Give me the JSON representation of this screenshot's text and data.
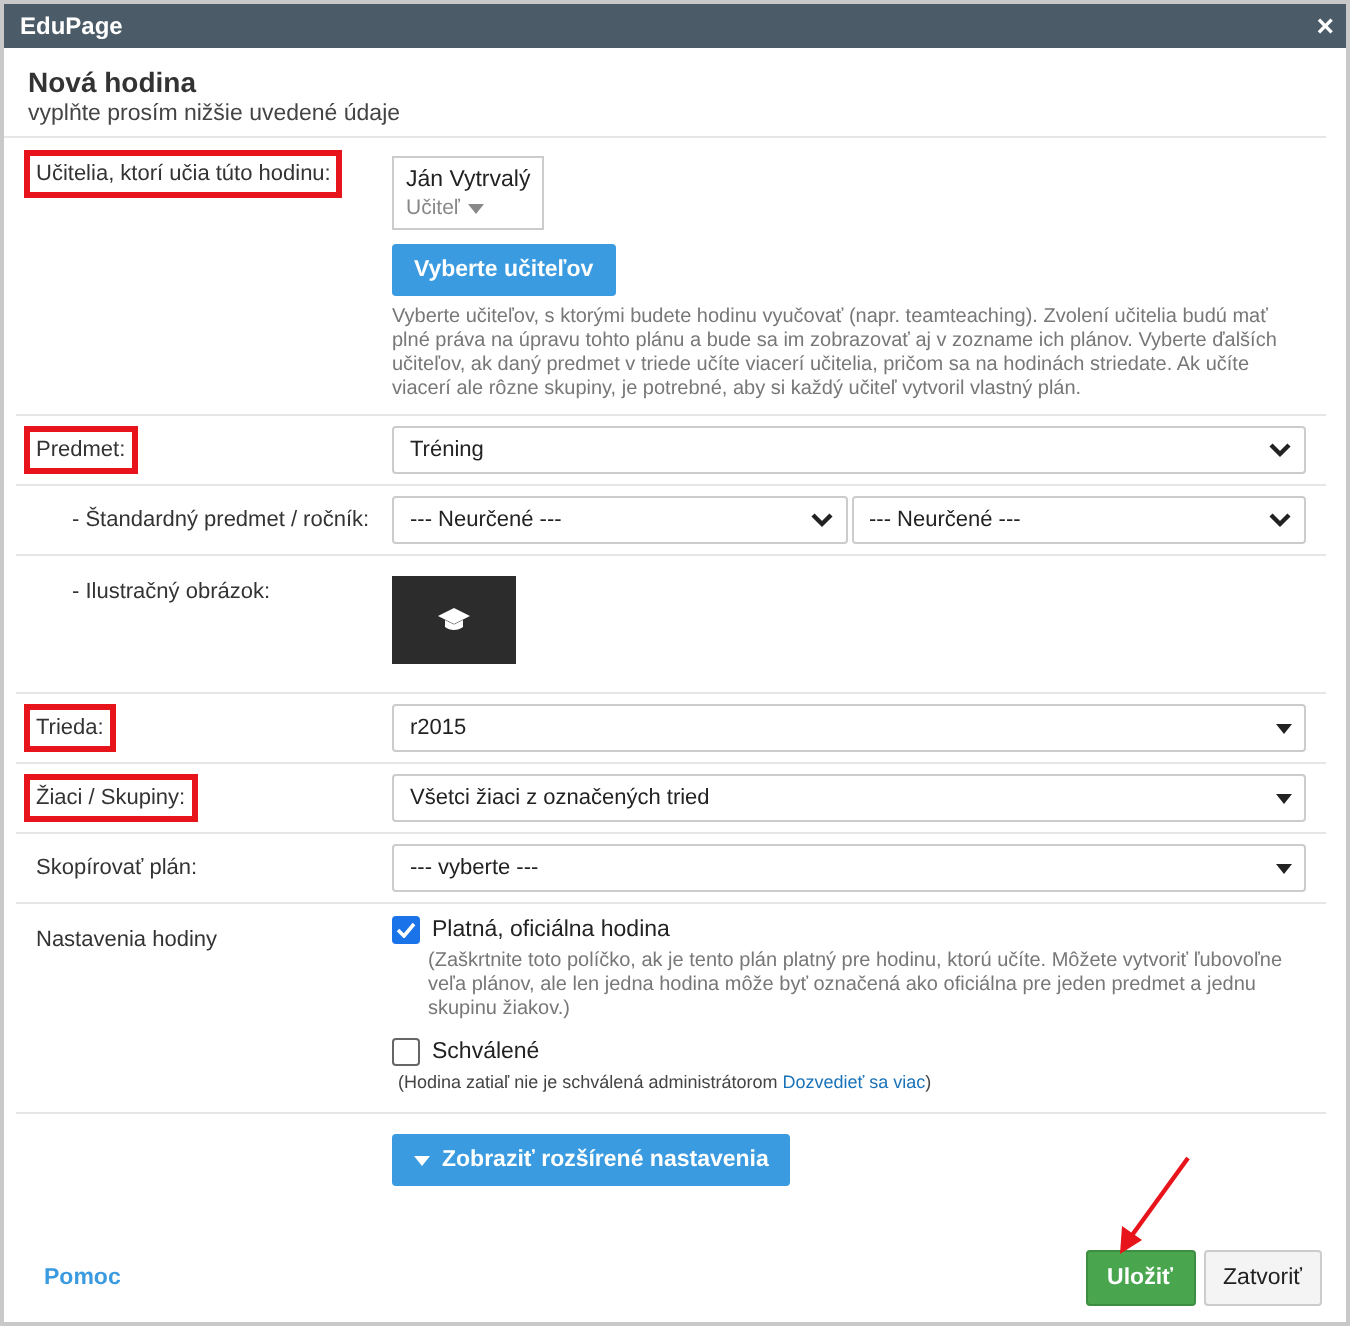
{
  "window": {
    "title": "EduPage",
    "close": "×"
  },
  "header": {
    "title": "Nová hodina",
    "subtitle": "vyplňte prosím nižšie uvedené údaje"
  },
  "rows": [
    {
      "kind": "teachers",
      "label": "Učitelia, ktorí učia túto hodinu:",
      "highlighted": true,
      "teacher": {
        "name": "Ján Vytrvalý",
        "role": "Učiteľ"
      },
      "button": "Vyberte učiteľov",
      "note": "Vyberte učiteľov, s ktorými budete hodinu vyučovať (napr. teamteaching). Zvolení učitelia budú mať plné práva na úpravu tohto plánu a bude sa im zobrazovať aj v zozname ich plánov. Vyberte ďalších učiteľov, ak daný predmet v triede učíte viacerí učitelia, pričom sa na hodinách striedate. Ak učíte viacerí ale rôzne skupiny, je potrebné, aby si každý učiteľ vytvoril vlastný plán."
    },
    {
      "kind": "select",
      "label": "Predmet:",
      "highlighted": true,
      "selects": [
        {
          "value": "Tréning",
          "kind": "chevron"
        }
      ],
      "children": [
        {
          "kind": "select",
          "label": "- Štandardný predmet / ročník:",
          "highlighted": false,
          "selects": [
            {
              "value": "--- Neurčené ---",
              "kind": "chevron"
            },
            {
              "value": "--- Neurčené ---",
              "kind": "chevron"
            }
          ]
        },
        {
          "kind": "image",
          "label": "- Ilustračný obrázok:",
          "highlighted": false
        }
      ]
    },
    {
      "kind": "select",
      "label": "Trieda:",
      "highlighted": true,
      "selects": [
        {
          "value": "r2015",
          "kind": "caret"
        }
      ]
    },
    {
      "kind": "select",
      "label": "Žiaci / Skupiny:",
      "highlighted": true,
      "selects": [
        {
          "value": "Všetci žiaci z označených tried",
          "kind": "caret"
        }
      ]
    },
    {
      "kind": "select",
      "label": "Skopírovať plán:",
      "highlighted": false,
      "selects": [
        {
          "value": "--- vyberte ---",
          "kind": "caret"
        }
      ]
    },
    {
      "kind": "checkboxes",
      "label": "Nastavenia hodiny",
      "highlighted": false,
      "options": [
        {
          "label": "Platná, oficiálna hodina",
          "checked": true,
          "note": "(Zaškrtnite toto políčko, ak je tento plán platný pre hodinu, ktorú učíte. Môžete vytvoriť ľubovoľne veľa plánov, ale len jedna hodina môže byť označená ako oficiálna pre jeden predmet a jednu skupinu žiakov.)"
        },
        {
          "label": "Schválené",
          "checked": false,
          "note": "(Hodina zatiaľ nie je schválená administrátorom",
          "link": "Dozvedieť sa viac",
          "note_end": ")"
        }
      ]
    }
  ],
  "expand_button": "Zobraziť rozšírené nastavenia",
  "footer": {
    "help": "Pomoc",
    "buttons": [
      {
        "label": "Uložiť",
        "primary": true,
        "pointed": true
      },
      {
        "label": "Zatvoriť",
        "primary": false,
        "pointed": false
      }
    ]
  }
}
